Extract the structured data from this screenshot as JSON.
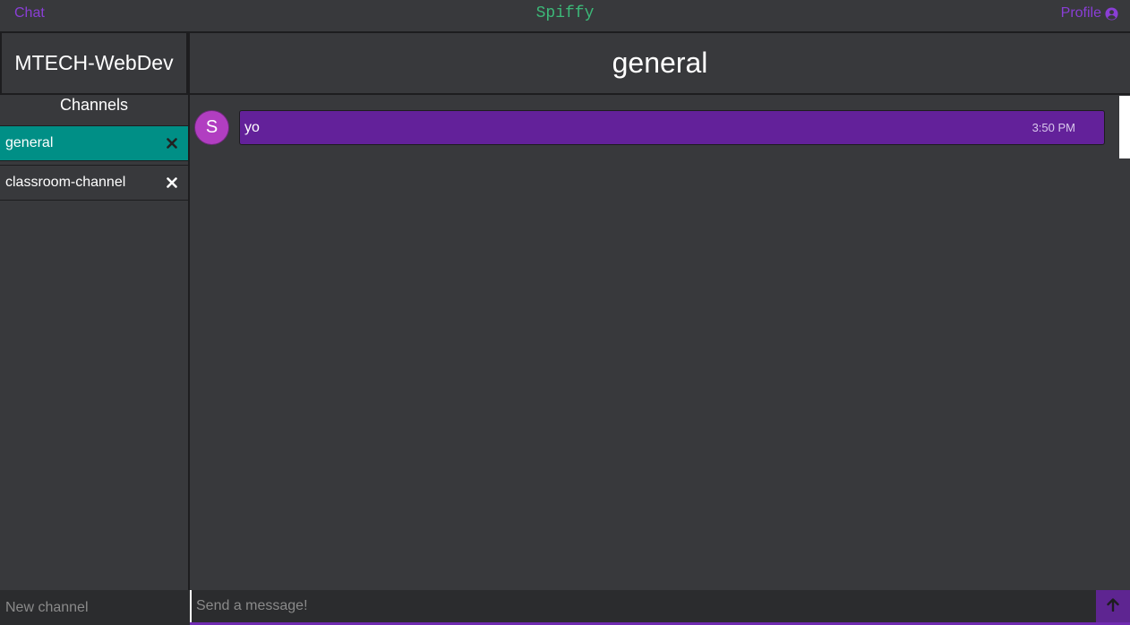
{
  "nav": {
    "chat_label": "Chat",
    "brand": "Spiffy",
    "profile_label": "Profile",
    "profile_icon": "user-circle-icon"
  },
  "colors": {
    "accent": "#8a3ed6",
    "brand": "#3cb878",
    "active_channel": "#008f86",
    "message_bubble": "#63219a",
    "avatar": "#b13ec1"
  },
  "sidebar": {
    "workspace": "MTECH-WebDev",
    "channels_heading": "Channels",
    "channels": [
      {
        "name": "general",
        "active": true,
        "close_icon": "close-icon"
      },
      {
        "name": "classroom-channel",
        "active": false,
        "close_icon": "close-icon"
      }
    ],
    "new_channel_placeholder": "New channel",
    "add_icon": "plus-icon"
  },
  "main": {
    "channel_title": "general",
    "messages": [
      {
        "avatar_initial": "S",
        "text": "yo",
        "time": "3:50 PM"
      }
    ],
    "composer_placeholder": "Send a message!",
    "send_icon": "arrow-up-icon"
  }
}
